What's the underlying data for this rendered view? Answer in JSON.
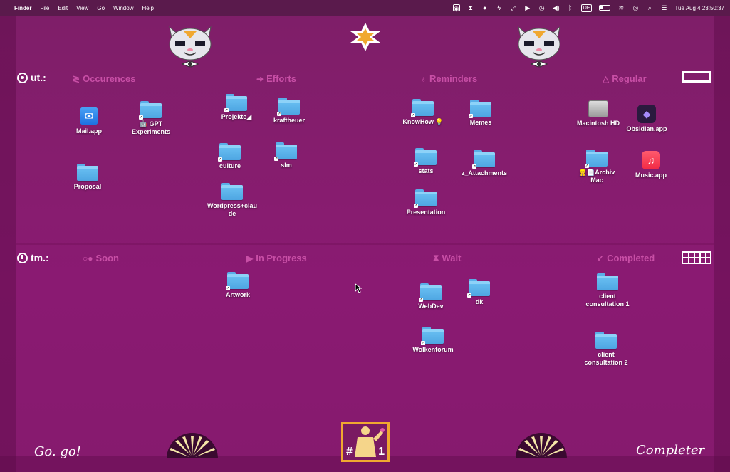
{
  "menubar": {
    "app_name": "Finder",
    "menus": [
      "File",
      "Edit",
      "View",
      "Go",
      "Window",
      "Help"
    ],
    "keyboard_layout": "DE",
    "clock": "Tue Aug 4  23:50:37"
  },
  "rows": {
    "top": {
      "label": "ut.:"
    },
    "bottom": {
      "label": "tm.:"
    }
  },
  "categories": {
    "occurences": "Occurences",
    "efforts": "Efforts",
    "reminders": "Reminders",
    "regular": "Regular",
    "soon": "Soon",
    "in_progress": "In Progress",
    "wait": "Wait",
    "completed": "Completed"
  },
  "icons": {
    "mail": "Mail.app",
    "gpt": "🤖 GPT Experiments",
    "proposal": "Proposal",
    "projekte": "Projekte◢",
    "kraftheuer": "kraftheuer",
    "culture": "culture",
    "slm": "slm",
    "wordpress": "Wordpress+claude",
    "knowhow": "KnowHow 💡",
    "memes": "Memes",
    "stats": "stats",
    "attachments": "z_Attachments",
    "presentation": "Presentation",
    "macintosh": "Macintosh HD",
    "obsidian": "Obsidian.app",
    "archiv": "👷📄Archiv Mac",
    "music": "Music.app",
    "artwork": "Artwork",
    "webdev": "WebDev",
    "dk": "dk",
    "wolkenforum": "Wolkenforum",
    "client1": "client consultation 1",
    "client2": "client consultation 2"
  },
  "footer": {
    "left_script": "Go. go!",
    "right_script": "Completer",
    "badge_left": "#",
    "badge_right": "1"
  }
}
